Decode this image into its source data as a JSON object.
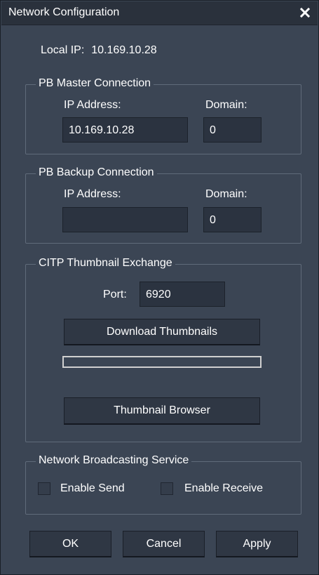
{
  "window": {
    "title": "Network Configuration"
  },
  "local_ip": {
    "label": "Local IP:",
    "value": "10.169.10.28"
  },
  "master": {
    "legend": "PB Master Connection",
    "ip_label": "IP Address:",
    "domain_label": "Domain:",
    "ip_value": "10.169.10.28",
    "domain_value": "0"
  },
  "backup": {
    "legend": "PB Backup Connection",
    "ip_label": "IP Address:",
    "domain_label": "Domain:",
    "ip_value": "",
    "domain_value": "0"
  },
  "citp": {
    "legend": "CITP Thumbnail Exchange",
    "port_label": "Port:",
    "port_value": "6920",
    "download_label": "Download Thumbnails",
    "progress": 0,
    "browser_label": "Thumbnail Browser"
  },
  "broadcast": {
    "legend": "Network Broadcasting Service",
    "send_label": "Enable Send",
    "send_checked": false,
    "receive_label": "Enable Receive",
    "receive_checked": false
  },
  "footer": {
    "ok_label": "OK",
    "cancel_label": "Cancel",
    "apply_label": "Apply"
  },
  "icons": {
    "close": "close-icon"
  }
}
